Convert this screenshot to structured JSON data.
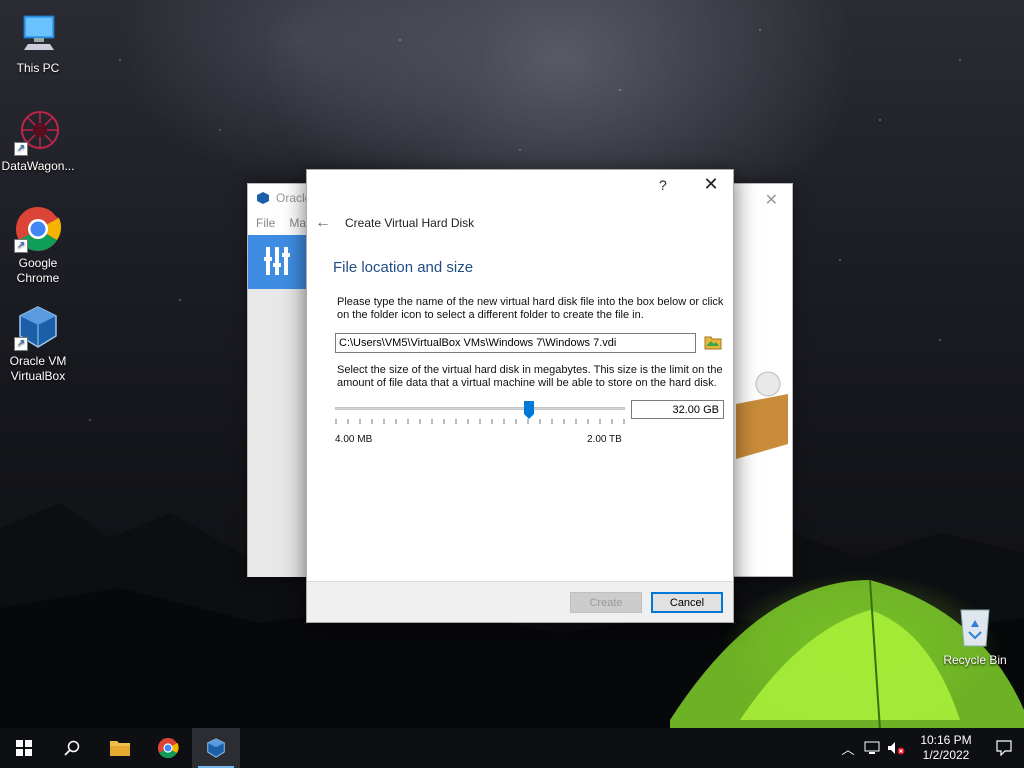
{
  "desktop": {
    "icons": [
      {
        "label": "This PC"
      },
      {
        "label": "DataWagon..."
      },
      {
        "label": "Google Chrome"
      },
      {
        "label": "Oracle VM VirtualBox"
      },
      {
        "label": "Recycle Bin"
      }
    ]
  },
  "background_window": {
    "title": "Oracle",
    "menu": [
      "File",
      "Ma"
    ]
  },
  "dialog": {
    "help_label": "?",
    "wizard_title": "Create Virtual Hard Disk",
    "heading": "File location and size",
    "location_description": "Please type the name of the new virtual hard disk file into the box below or click on the folder icon to select a different folder to create the file in.",
    "file_path": "C:\\Users\\VM5\\VirtualBox VMs\\Windows 7\\Windows 7.vdi",
    "size_description": "Select the size of the virtual hard disk in megabytes. This size is the limit on the amount of file data that a virtual machine will be able to store on the hard disk.",
    "size_value": "32.00 GB",
    "slider_fraction": 0.67,
    "range_min": "4.00 MB",
    "range_max": "2.00 TB",
    "create_label": "Create",
    "cancel_label": "Cancel"
  },
  "taskbar": {
    "time": "10:16 PM",
    "date": "1/2/2022"
  },
  "colors": {
    "accent": "#0078d7",
    "heading": "#1f4e85",
    "vbox_blue": "#3f8de3"
  }
}
